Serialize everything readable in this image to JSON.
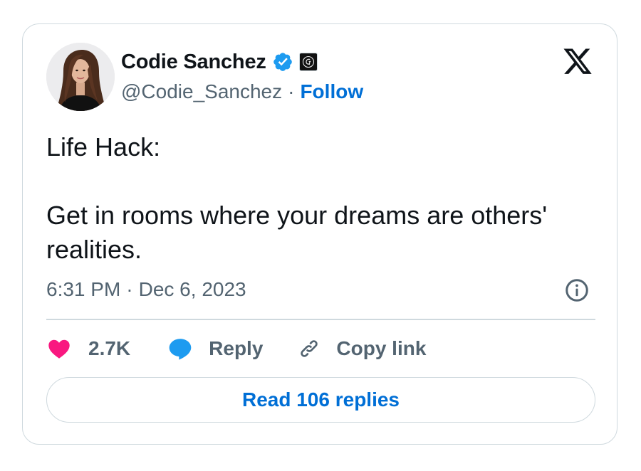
{
  "author": {
    "display_name": "Codie Sanchez",
    "handle": "@Codie_Sanchez",
    "separator": "·",
    "follow_label": "Follow",
    "verified_icon": "verified-badge-icon",
    "affiliate_icon": "affiliate-badge-icon"
  },
  "tweet": {
    "lines": [
      "Life Hack:",
      "",
      "Get in rooms where your dreams are others'",
      "realities."
    ],
    "time": "6:31 PM",
    "separator": "·",
    "date": "Dec 6, 2023"
  },
  "actions": {
    "likes_count": "2.7K",
    "reply_label": "Reply",
    "copy_link_label": "Copy link"
  },
  "read_replies_label": "Read 106 replies",
  "colors": {
    "accent": "#006fd6",
    "like": "#f91880",
    "reply": "#1d9bf0",
    "muted_text": "#536471",
    "border": "#cfd9de",
    "text": "#0f1419"
  }
}
